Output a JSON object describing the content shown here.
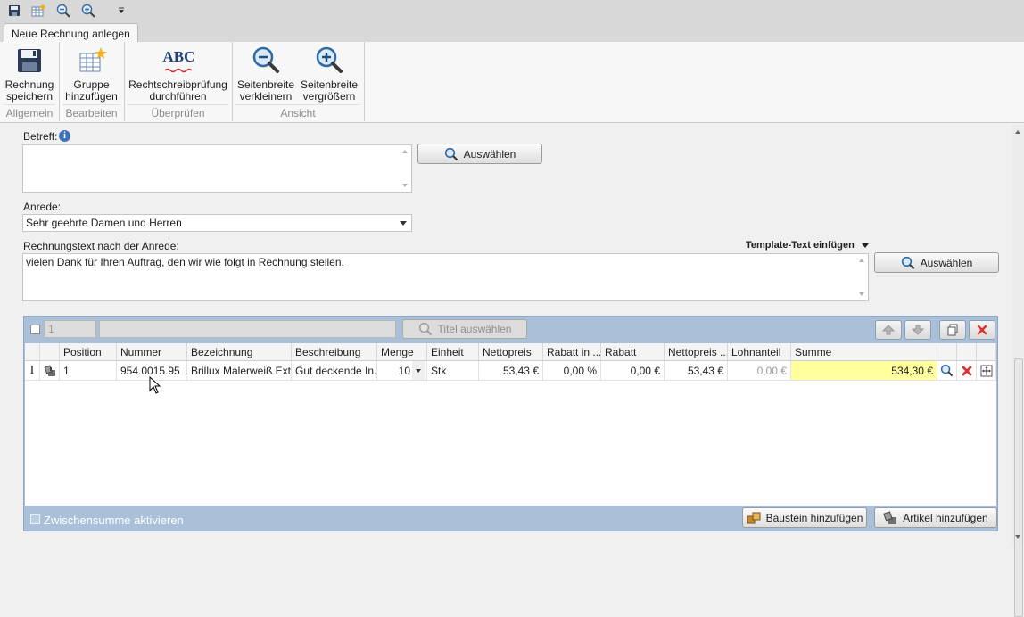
{
  "ribbon": {
    "tab": "Neue Rechnung anlegen",
    "groups": {
      "allgemein": "Allgemein",
      "bearbeiten": "Bearbeiten",
      "ueberpruefen": "Überprüfen",
      "ansicht": "Ansicht"
    },
    "buttons": {
      "save_l1": "Rechnung",
      "save_l2": "speichern",
      "group_l1": "Gruppe",
      "group_l2": "hinzufügen",
      "spell_l1": "Rechtschreibprüfung",
      "spell_l2": "durchführen",
      "zoomout_l1": "Seitenbreite",
      "zoomout_l2": "verkleinern",
      "zoomin_l1": "Seitenbreite",
      "zoomin_l2": "vergrößern"
    },
    "abc_text": "ABC"
  },
  "form": {
    "betreff_label": "Betreff:",
    "betreff_value": "",
    "auswaehlen": "Auswählen",
    "anrede_label": "Anrede:",
    "anrede_value": "Sehr geehrte Damen und Herren",
    "text_label": "Rechnungstext nach der Anrede:",
    "template_link": "Template-Text einfügen",
    "text_value": "vielen Dank für Ihren Auftrag, den wir wie folgt in Rechnung stellen."
  },
  "positions": {
    "number_value": "1",
    "title_value": "",
    "title_select": "Titel auswählen",
    "columns": [
      "Position",
      "Nummer",
      "Bezeichnung",
      "Beschreibung",
      "Menge",
      "Einheit",
      "Nettopreis",
      "Rabatt in ...",
      "Rabatt",
      "Nettopreis ...",
      "Lohnanteil",
      "Summe"
    ],
    "row": {
      "position": "1",
      "nummer": "954.0015.95",
      "bezeichnung": "Brillux Malerweiß Ext...",
      "beschreibung": "Gut deckende In...",
      "menge": "10",
      "einheit": "Stk",
      "nettopreis": "53,43 €",
      "rabatt_pct": "0,00 %",
      "rabatt": "0,00 €",
      "nettopreis2": "53,43 €",
      "lohnanteil": "0,00 €",
      "summe": "534,30 €"
    },
    "subtotal_label": "Zwischensumme aktivieren",
    "add_module": "Baustein hinzufügen",
    "add_article": "Artikel hinzufügen"
  },
  "colors": {
    "panel": "#a9c0d8",
    "summe_bg": "#ffff9e",
    "delete_red": "#d9342b"
  }
}
